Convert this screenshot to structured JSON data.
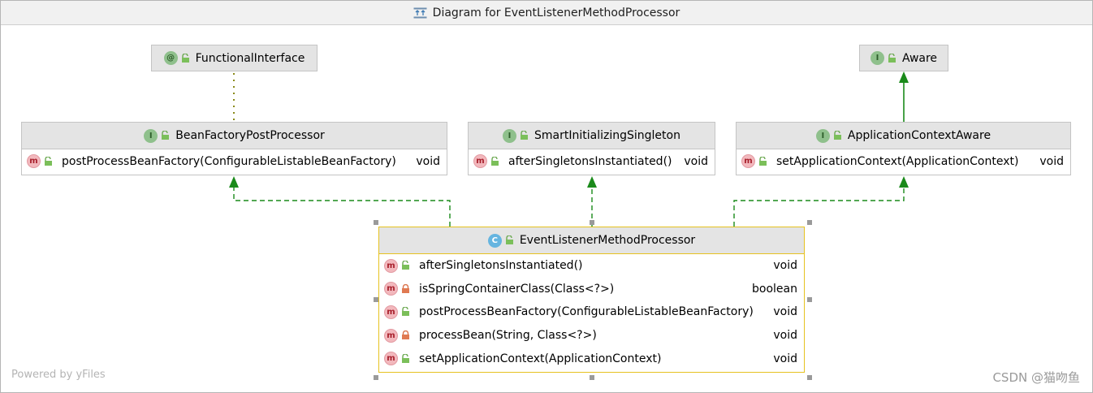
{
  "window": {
    "title": "Diagram for EventListenerMethodProcessor",
    "title_icon": "diagram-icon"
  },
  "nodes": {
    "functional_interface": {
      "name": "FunctionalInterface",
      "kind": "annotation"
    },
    "aware": {
      "name": "Aware",
      "kind": "interface"
    },
    "bean_factory_post_processor": {
      "name": "BeanFactoryPostProcessor",
      "kind": "interface",
      "methods": [
        {
          "name": "postProcessBeanFactory(ConfigurableListableBeanFactory)",
          "type": "void"
        }
      ]
    },
    "smart_initializing_singleton": {
      "name": "SmartInitializingSingleton",
      "kind": "interface",
      "methods": [
        {
          "name": "afterSingletonsInstantiated()",
          "type": "void"
        }
      ]
    },
    "application_context_aware": {
      "name": "ApplicationContextAware",
      "kind": "interface",
      "methods": [
        {
          "name": "setApplicationContext(ApplicationContext)",
          "type": "void"
        }
      ]
    },
    "event_listener_method_processor": {
      "name": "EventListenerMethodProcessor",
      "kind": "class",
      "methods": [
        {
          "name": "afterSingletonsInstantiated()",
          "type": "void",
          "visibility": "public"
        },
        {
          "name": "isSpringContainerClass(Class<?>)",
          "type": "boolean",
          "visibility": "private"
        },
        {
          "name": "postProcessBeanFactory(ConfigurableListableBeanFactory)",
          "type": "void",
          "visibility": "public"
        },
        {
          "name": "processBean(String, Class<?>)",
          "type": "void",
          "visibility": "private"
        },
        {
          "name": "setApplicationContext(ApplicationContext)",
          "type": "void",
          "visibility": "public"
        }
      ]
    }
  },
  "badges": {
    "interface": "I",
    "annotation": "@",
    "class": "C",
    "method": "m"
  },
  "footer": {
    "powered_by": "Powered by yFiles",
    "credit": "CSDN @猫吻鱼"
  },
  "colors": {
    "arrow": "#1a8a1a",
    "selection": "#e6c220"
  }
}
